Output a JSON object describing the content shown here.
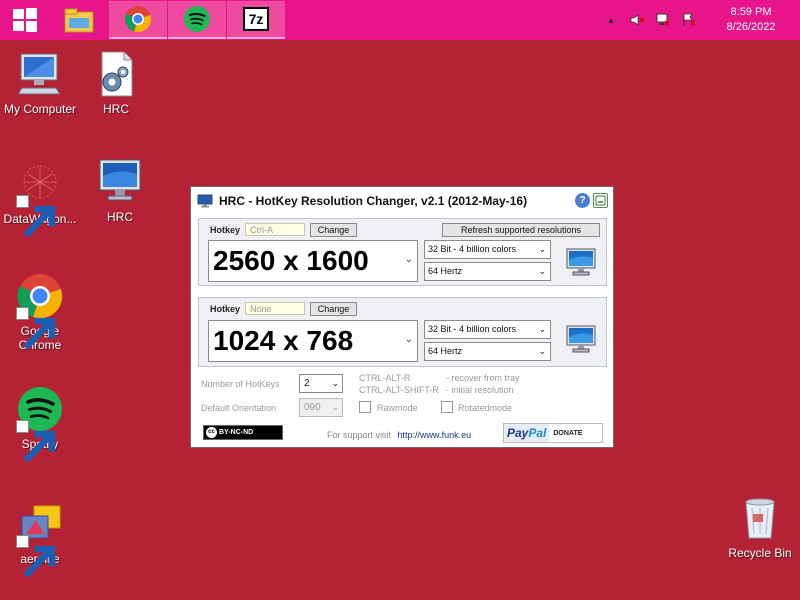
{
  "taskbar": {
    "pinned": [
      {
        "name": "file-explorer"
      },
      {
        "name": "chrome"
      },
      {
        "name": "spotify"
      },
      {
        "name": "7zip",
        "label": "7z"
      }
    ],
    "tray": {
      "arrow": "▲",
      "time": "8:59 PM",
      "date": "8/26/2022"
    },
    "color": "#e8158a"
  },
  "desktop": {
    "background": "#b52236",
    "icons": [
      {
        "label": "My Computer"
      },
      {
        "label": "HRC"
      },
      {
        "label": "DataWagon..."
      },
      {
        "label": "HRC"
      },
      {
        "label": "Google Chrome"
      },
      {
        "label": "Spotify"
      },
      {
        "label": "aerolite"
      },
      {
        "label": "Recycle Bin"
      }
    ]
  },
  "window": {
    "title": "HRC - HotKey Resolution Changer, v2.1 (2012-May-16)",
    "controls": {
      "help": "?",
      "close": "×"
    },
    "refresh_label": "Refresh supported resolutions",
    "profile1": {
      "hotkey_label": "Hotkey",
      "hotkey_value": "Ctrl-A",
      "change_label": "Change",
      "resolution": "2560 x 1600",
      "color_depth": "32 Bit - 4 billion colors",
      "refresh_rate": "64 Hertz"
    },
    "profile2": {
      "hotkey_label": "Hotkey",
      "hotkey_value": "None",
      "change_label": "Change",
      "resolution": "1024 x 768",
      "color_depth": "32 Bit - 4 billion colors",
      "refresh_rate": "64 Hertz"
    },
    "options": {
      "num_hotkeys_label": "Number of HotKeys",
      "num_hotkeys_value": "2",
      "orientation_label": "Default Orientation",
      "orientation_value": "090",
      "shortcut1_keys": "CTRL-ALT-R",
      "shortcut1_desc": "- recover from tray",
      "shortcut2_keys": "CTRL-ALT-SHIFT-R",
      "shortcut2_desc": "- initial resolution",
      "rawmode_label": "Rawmode",
      "rotatedmode_label": "Rotatedmode"
    },
    "footer": {
      "license": "BY-NC-ND",
      "support_text": "For support visit",
      "support_url": "http://www.funk.eu",
      "paypal_pay": "Pay",
      "paypal_pal": "Pal",
      "donate": "DONATE"
    }
  }
}
